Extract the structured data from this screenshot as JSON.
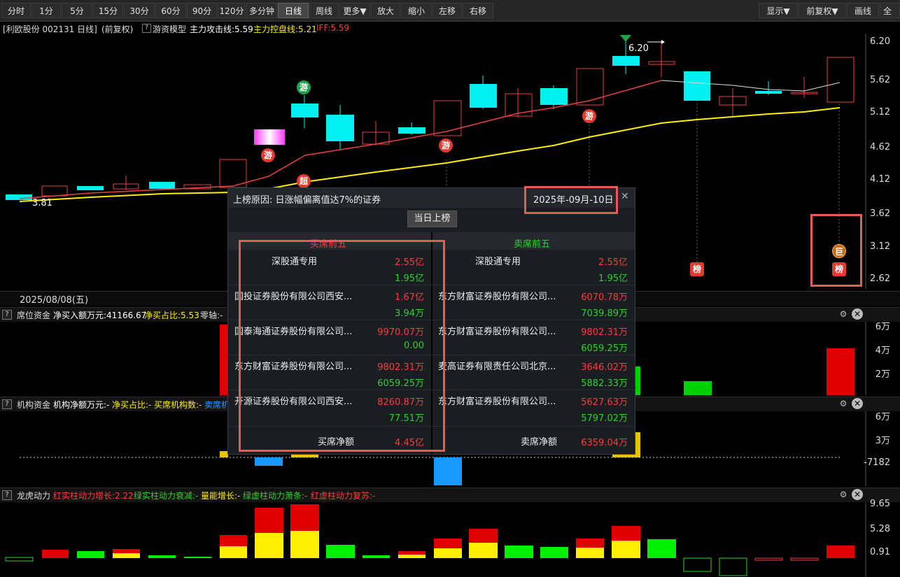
{
  "toolbar": {
    "periods": [
      "分时",
      "1分",
      "5分",
      "15分",
      "30分",
      "60分",
      "90分",
      "120分",
      "多分钟",
      "日线",
      "周线",
      "更多▼"
    ],
    "active": "日线",
    "actions": [
      "放大",
      "缩小",
      "左移",
      "右移"
    ],
    "right": [
      "显示▼",
      "前复权▼",
      "画线",
      "全局"
    ]
  },
  "chart_header": {
    "stock": "[利欧股份 002131 日线]",
    "adjust": "(前复权)",
    "model": "游资模型",
    "attack": "主力攻击线:5.59",
    "control": "主力控盘线:5.21",
    "iff": "IFF:5.59"
  },
  "price_axis": [
    "6.20",
    "5.62",
    "5.12",
    "4.62",
    "4.12",
    "3.62",
    "3.12",
    "2.62"
  ],
  "price_annotations": {
    "high": "6.20",
    "low": "3.81"
  },
  "markers": {
    "you": "游",
    "chao": "超",
    "bang": "榜",
    "ju": "巨"
  },
  "date_label": "2025/08/08(五)",
  "panels": {
    "seat": {
      "name": "席位资金",
      "net": "净买入额万元:41166.67",
      "ratio": "净买占比:5.53",
      "zero": "零轴:-",
      "axis": [
        "6万",
        "4万",
        "2万"
      ]
    },
    "inst": {
      "name": "机构资金",
      "net": "机构净额万元:-",
      "ratio": "净买占比:-",
      "count": "买席机构数:-",
      "sell": "卖席机",
      "axis": [
        "6万",
        "3万",
        "-7182"
      ]
    },
    "dragon": {
      "name": "龙虎动力",
      "f1": "红实柱动力增长:2.22",
      "f2": "绿实柱动力衰减:-",
      "f3": "量能增长:-",
      "f4": "绿虚柱动力萧条:-",
      "f5": "红虚柱动力复苏:-",
      "axis": [
        "9.65",
        "5.28",
        "0.91"
      ]
    }
  },
  "popup": {
    "reason": "上榜原因: 日涨幅偏离值达7%的证券",
    "date": "2025年-09月-10日",
    "tab": "当日上榜",
    "buy_title": "买席前五",
    "sell_title": "卖席前五",
    "buy": [
      {
        "name": "深股通专用",
        "buy": "2.55亿",
        "sell": "1.95亿"
      },
      {
        "name": "国投证券股份有限公司西安...",
        "buy": "1.67亿",
        "sell": "3.94万"
      },
      {
        "name": "国泰海通证券股份有限公司...",
        "buy": "9970.07万",
        "sell": "0.00"
      },
      {
        "name": "东方财富证券股份有限公司...",
        "buy": "9802.31万",
        "sell": "6059.25万"
      },
      {
        "name": "开源证券股份有限公司西安...",
        "buy": "8260.87万",
        "sell": "77.51万"
      }
    ],
    "sell": [
      {
        "name": "深股通专用",
        "buy": "2.55亿",
        "sell": "1.95亿"
      },
      {
        "name": "东方财富证券股份有限公司...",
        "buy": "6070.78万",
        "sell": "7039.89万"
      },
      {
        "name": "东方财富证券股份有限公司...",
        "buy": "9802.31万",
        "sell": "6059.25万"
      },
      {
        "name": "麦高证券有限责任公司北京...",
        "buy": "3646.02万",
        "sell": "5882.33万"
      },
      {
        "name": "东方财富证券股份有限公司...",
        "buy": "5627.63万",
        "sell": "5797.02万"
      }
    ],
    "buy_net_label": "买席净额",
    "buy_net": "4.45亿",
    "sell_net_label": "卖席净额",
    "sell_net": "6359.04万"
  }
}
